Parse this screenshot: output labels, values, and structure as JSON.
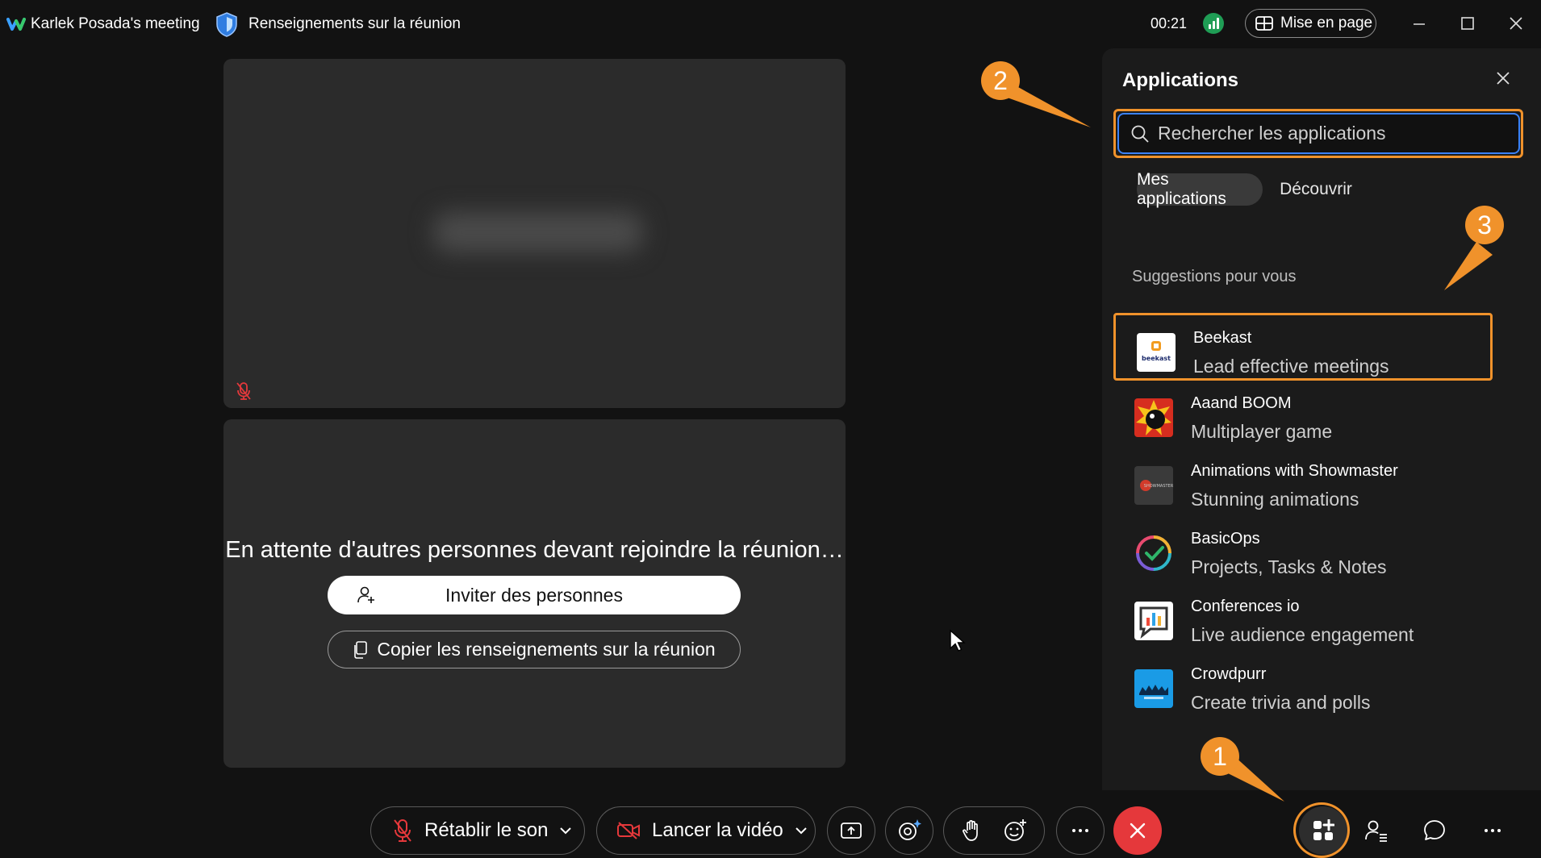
{
  "titlebar": {
    "meeting_title": "Karlek Posada's meeting",
    "info_link": "Renseignements sur la réunion",
    "timer": "00:21",
    "layout_label": "Mise en page"
  },
  "stage": {
    "waiting_text": "En attente d'autres personnes devant rejoindre la réunion…",
    "invite_label": "Inviter des personnes",
    "copy_label": "Copier les renseignements sur la réunion"
  },
  "apps_panel": {
    "title": "Applications",
    "search_placeholder": "Rechercher les applications",
    "tabs": [
      "Mes applications",
      "Découvrir"
    ],
    "section_label": "Suggestions pour vous",
    "items": [
      {
        "name": "Beekast",
        "desc": "Lead effective meetings",
        "icon": "beekast-logo"
      },
      {
        "name": "Aaand BOOM",
        "desc": "Multiplayer game",
        "icon": "bomb-logo"
      },
      {
        "name": "Animations with Showmaster",
        "desc": "Stunning animations",
        "icon": "showmaster-logo"
      },
      {
        "name": "BasicOps",
        "desc": "Projects, Tasks & Notes",
        "icon": "basicops-logo"
      },
      {
        "name": "Conferences io",
        "desc": "Live audience engagement",
        "icon": "conferences-io-logo"
      },
      {
        "name": "Crowdpurr",
        "desc": "Create trivia and polls",
        "icon": "crowdpurr-logo"
      }
    ]
  },
  "callouts": [
    "1",
    "2",
    "3"
  ],
  "toolbar": {
    "unmute_label": "Rétablir le son",
    "video_label": "Lancer la vidéo"
  },
  "colors": {
    "accent_orange": "#f0922b",
    "end_call_red": "#e5383b",
    "search_focus_blue": "#3b82f6",
    "tile_bg": "#2b2b2b"
  }
}
